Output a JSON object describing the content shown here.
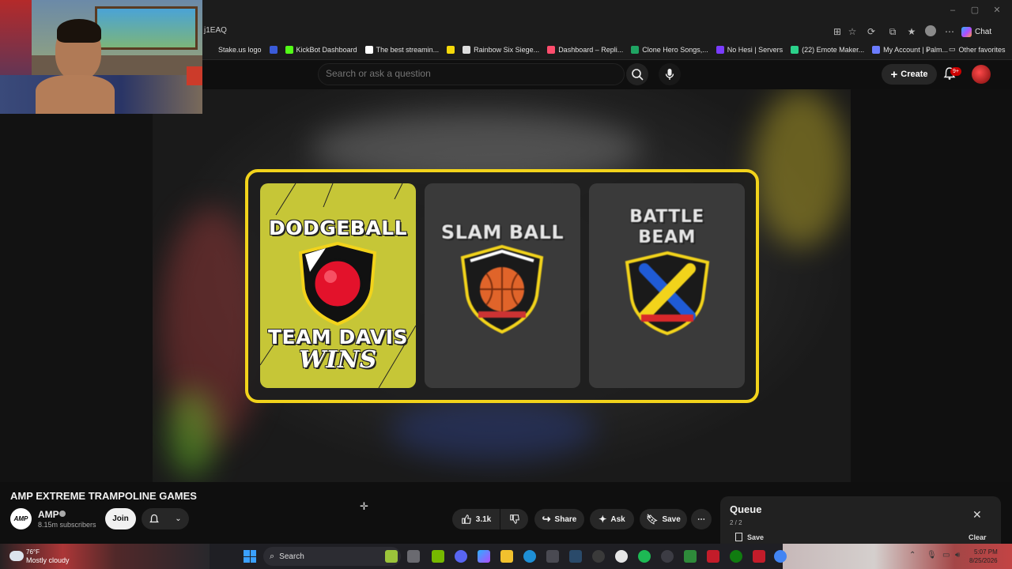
{
  "browser": {
    "url": "j1EAQ",
    "chat_label": "Chat",
    "bookmarks": [
      {
        "label": "Stake.us logo",
        "color": "#1c1c1c"
      },
      {
        "label": "",
        "color": "#3a5bd9"
      },
      {
        "label": "KickBot Dashboard",
        "color": "#53fc18"
      },
      {
        "label": "The best streamin...",
        "color": "#ffffff"
      },
      {
        "label": "",
        "color": "#f5d90a"
      },
      {
        "label": "Rainbow Six Siege...",
        "color": "#dddddd"
      },
      {
        "label": "Dashboard – Repli...",
        "color": "#ff4d6d"
      },
      {
        "label": "Clone Hero Songs,...",
        "color": "#1fa463"
      },
      {
        "label": "No Hesi | Servers",
        "color": "#7a3cff"
      },
      {
        "label": "(22) Emote Maker...",
        "color": "#2bd18a"
      },
      {
        "label": "My Account | Palm...",
        "color": "#6b7cff"
      }
    ],
    "other_favorites": "Other favorites"
  },
  "youtube": {
    "search_placeholder": "Search or ask a question",
    "create_label": "Create",
    "notif_badge": "9+"
  },
  "video": {
    "cards": [
      {
        "title": "DODGEBALL",
        "subtitle": "TEAM DAVIS",
        "tag": "WINS"
      },
      {
        "title": "SLAM BALL"
      },
      {
        "title_line1": "BATTLE",
        "title_line2": "BEAM"
      }
    ],
    "title": "AMP EXTREME TRAMPOLINE GAMES",
    "channel": {
      "avatar_text": "AMP",
      "name": "AMP",
      "subscribers": "8.15m subscribers",
      "join_label": "Join"
    },
    "actions": {
      "likes": "3.1k",
      "share": "Share",
      "ask": "Ask",
      "save": "Save"
    }
  },
  "queue": {
    "title": "Queue",
    "count": "2 / 2",
    "save_label": "Save",
    "clear_label": "Clear"
  },
  "taskbar": {
    "temperature": "76°F",
    "weather": "Mostly cloudy",
    "search_label": "Search",
    "time": "5:07 PM",
    "date": "8/25/2026"
  }
}
